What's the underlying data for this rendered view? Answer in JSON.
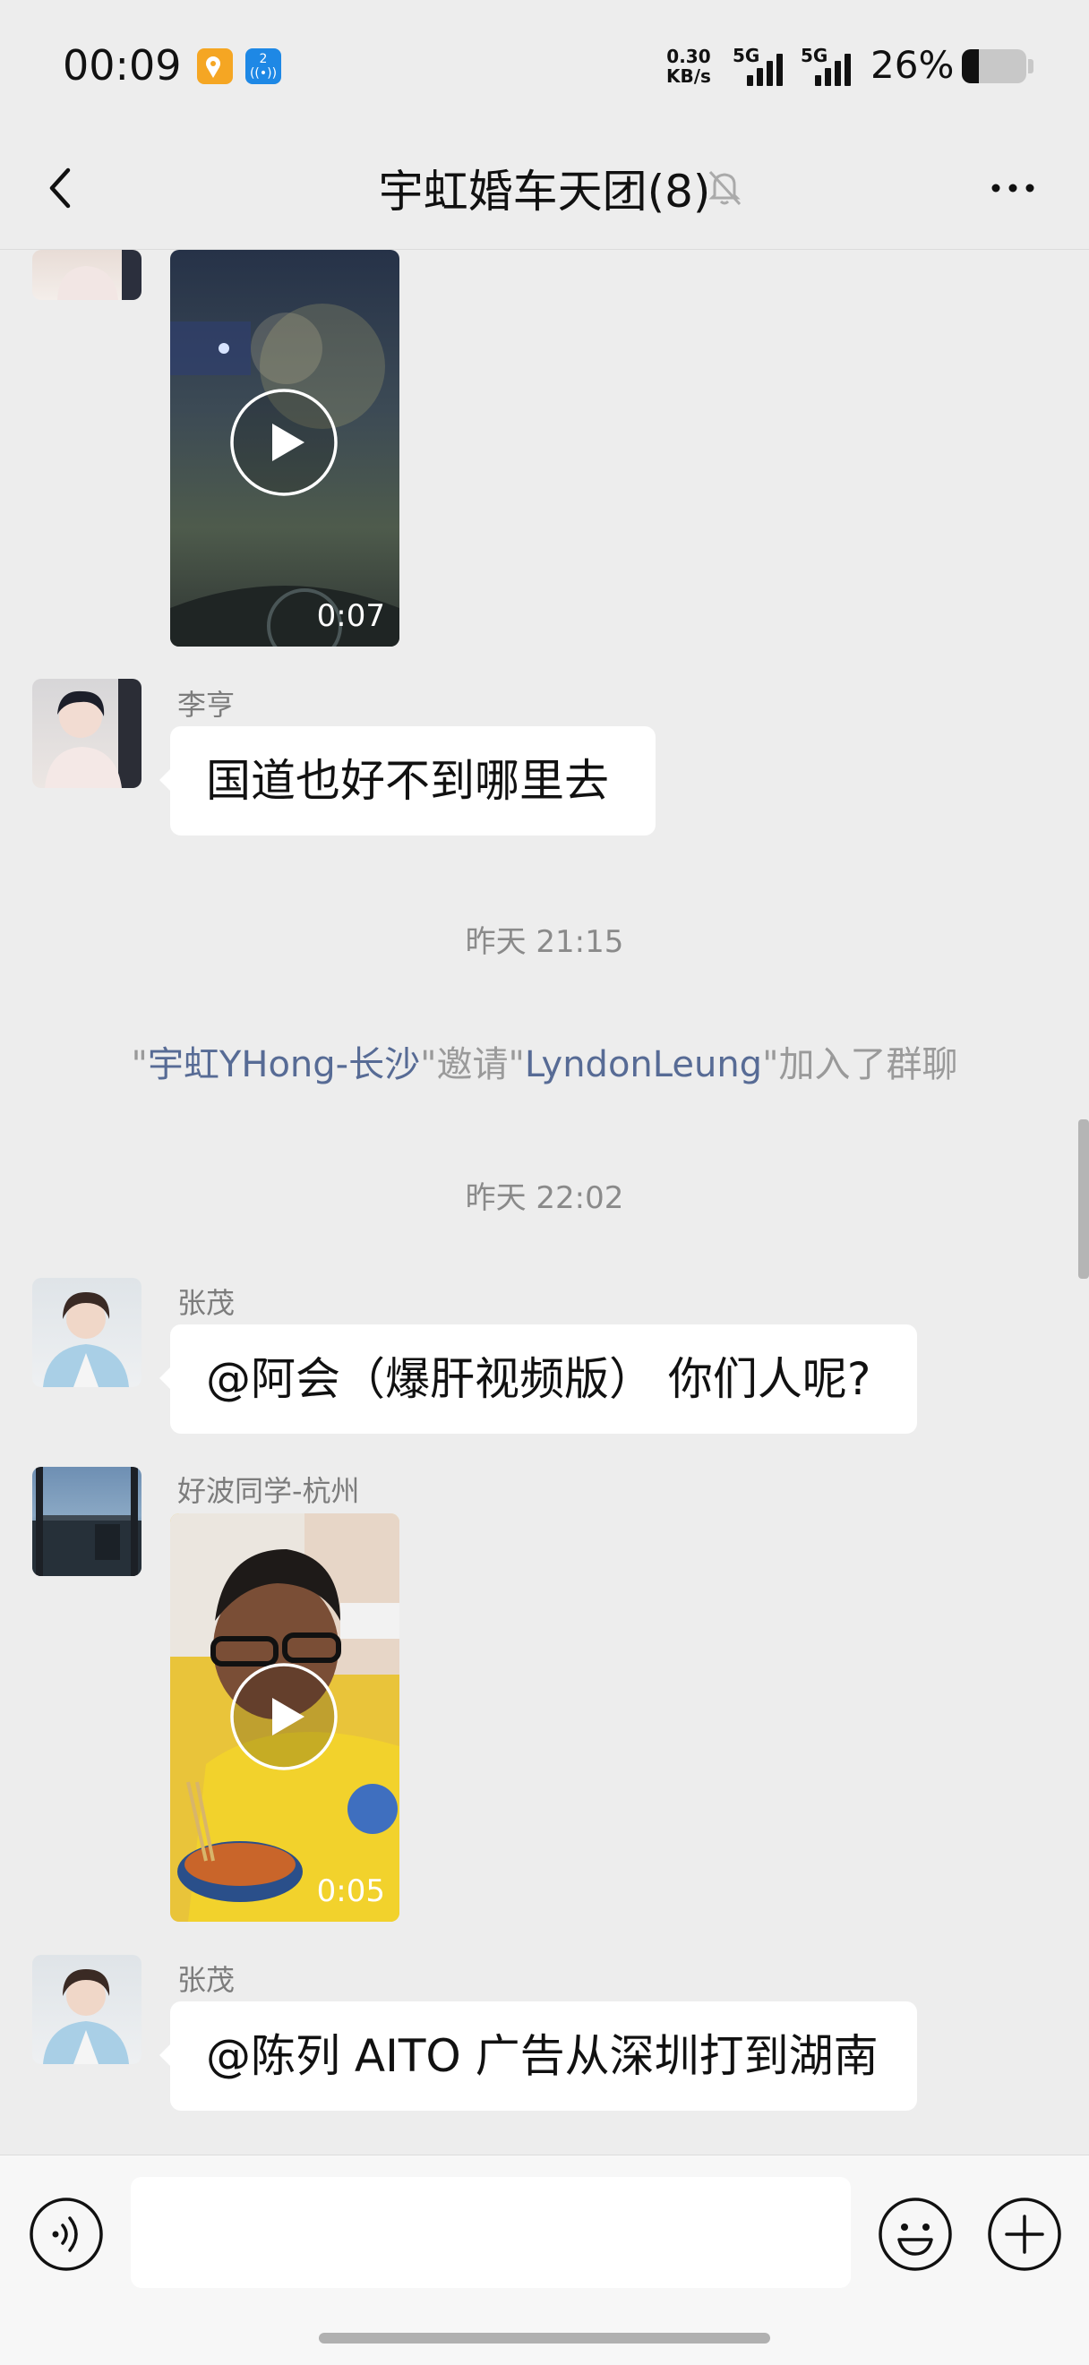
{
  "status_bar": {
    "time": "00:09",
    "net_speed_value": "0.30",
    "net_speed_unit": "KB/s",
    "signal1_label": "5G",
    "signal2_label": "5G",
    "battery_percent": "26%",
    "battery_level": 0.26,
    "badge2_text": "2"
  },
  "nav": {
    "title": "宇虹婚车天团(8)",
    "back_icon": "chevron-left-icon",
    "mute_icon": "bell-off-icon",
    "more_icon": "more-dots-icon"
  },
  "messages": [
    {
      "type": "video",
      "duration": "0:07"
    },
    {
      "type": "text",
      "sender": "李亨",
      "text": "国道也好不到哪里去"
    },
    {
      "type": "time",
      "text": "昨天 21:15"
    },
    {
      "type": "system",
      "inviter": "宇虹YHong-长沙",
      "invitee": "LyndonLeung",
      "q": "\"",
      "verb": "邀请",
      "suffix": "加入了群聊"
    },
    {
      "type": "time",
      "text": "昨天 22:02"
    },
    {
      "type": "text",
      "sender": "张茂",
      "text": "@阿会（爆肝视频版） 你们人呢?"
    },
    {
      "type": "video",
      "sender": "好波同学-杭州",
      "duration": "0:05"
    },
    {
      "type": "text",
      "sender": "张茂",
      "text": "@陈列  AITO 广告从深圳打到湖南"
    }
  ],
  "input": {
    "value": "",
    "voice_icon": "voice-icon",
    "emoji_icon": "emoji-icon",
    "plus_icon": "plus-circle-icon"
  }
}
